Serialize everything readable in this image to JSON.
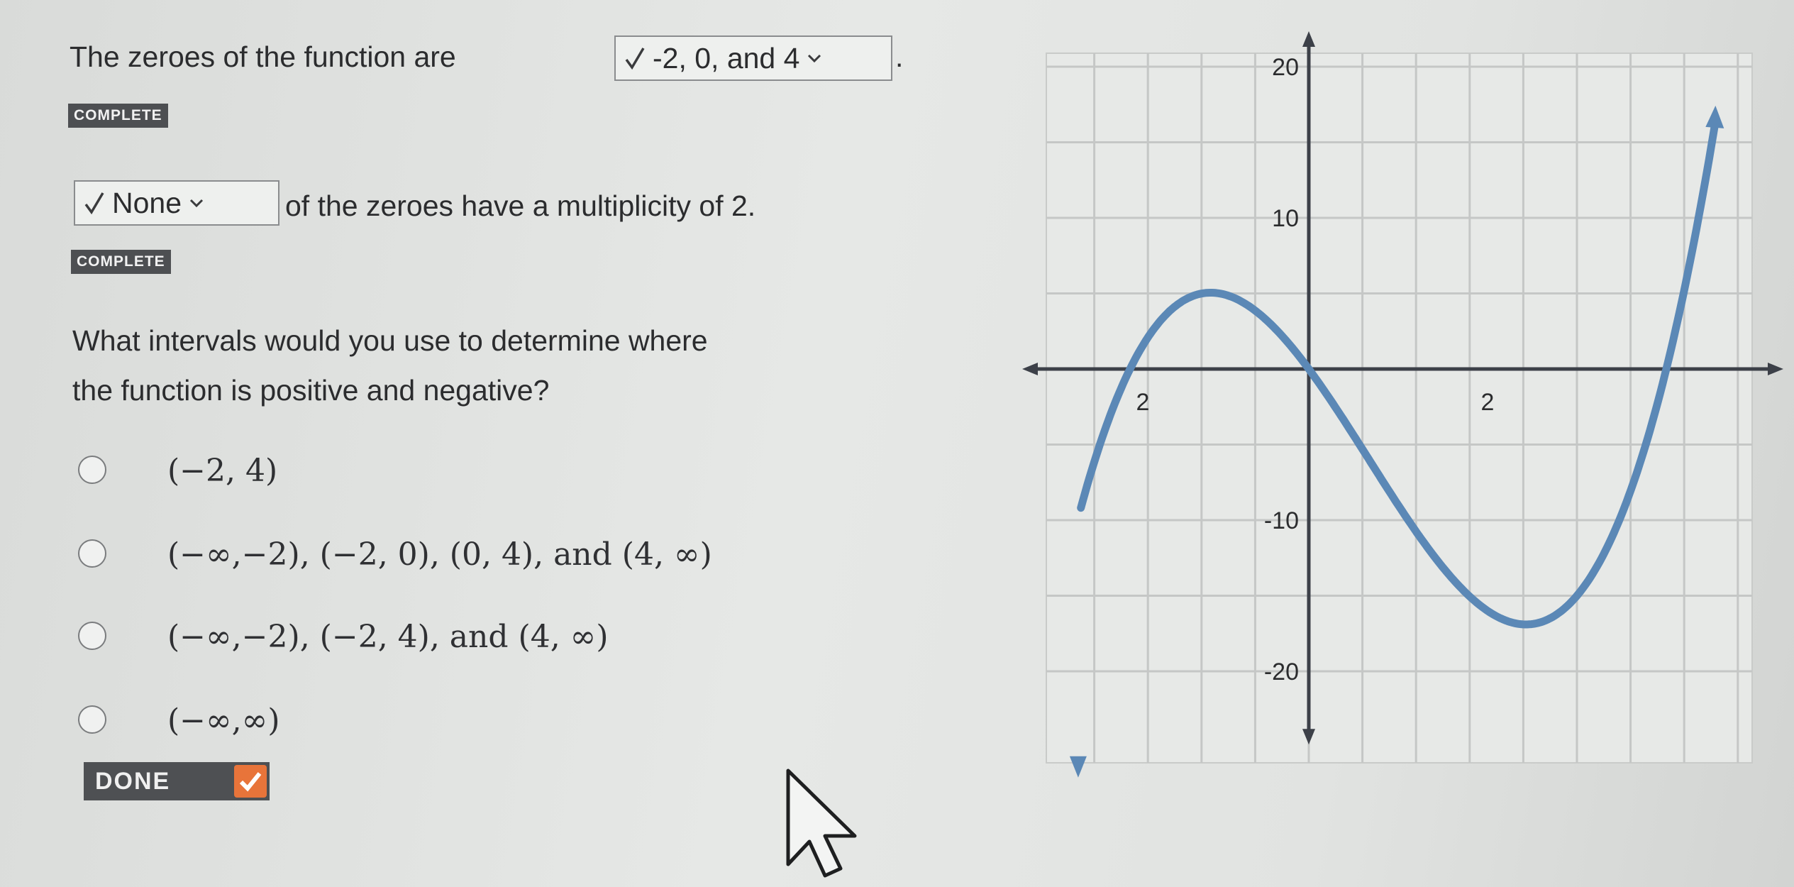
{
  "question1": {
    "prefix": "The zeroes of the function are",
    "dropdown_value": "-2, 0, and 4",
    "suffix": ".",
    "status": "COMPLETE"
  },
  "question2": {
    "dropdown_value": "None",
    "suffix": "of the zeroes have a multiplicity of 2.",
    "status": "COMPLETE"
  },
  "question3": {
    "prompt_line1": "What intervals would you use to determine where",
    "prompt_line2": "the function is positive and negative?",
    "options": [
      {
        "label": "(−2, 4)"
      },
      {
        "label": "(−∞,−2), (−2, 0), (0, 4), and (4, ∞)"
      },
      {
        "label": "(−∞,−2), (−2, 4), and (4, ∞)"
      },
      {
        "label": "(−∞,∞)"
      }
    ]
  },
  "done_button": {
    "label": "DONE"
  },
  "icons": {
    "check": "check-icon",
    "chevron": "chevron-down-icon",
    "cursor": "mouse-pointer-icon"
  },
  "colors": {
    "curve": "#5b88b6",
    "badge": "#4d4f52",
    "done_check": "#e8743a"
  },
  "chart_data": {
    "type": "line",
    "function": "x^3 - 2x^2 - 8x",
    "xlim": [
      -2.5,
      4.6
    ],
    "ylim": [
      -25,
      22
    ],
    "grid": true,
    "x_tick_labels": [
      {
        "value": -2,
        "label": "2"
      },
      {
        "value": 2,
        "label": "2"
      },
      {
        "value": 4,
        "label": ""
      }
    ],
    "y_tick_labels": [
      {
        "value": 20,
        "label": "20"
      },
      {
        "value": 10,
        "label": "10"
      },
      {
        "value": -10,
        "label": "-10"
      },
      {
        "value": -20,
        "label": "-20"
      }
    ],
    "series": [
      {
        "x": [
          -2.45,
          -2.3,
          -2.0,
          -1.7,
          -1.4,
          -1.1,
          -0.87,
          -0.6,
          -0.3,
          0.0,
          0.3,
          0.6,
          0.9,
          1.2,
          1.5,
          1.8,
          2.1,
          2.4,
          2.7,
          3.0,
          3.2,
          3.4,
          3.6,
          3.8,
          4.0,
          4.2,
          4.4,
          4.55
        ],
        "y": [
          -5.2,
          -1.9,
          0.0,
          3.9,
          6.3,
          7.1,
          6.06,
          6.2,
          2.2,
          0.0,
          -2.5,
          -5.3,
          -7.6,
          -9.6,
          -11.1,
          -12.0,
          -12.4,
          -12.0,
          -11.3,
          -9.0,
          -6.8,
          -4.6,
          -2.0,
          1.1,
          0.0,
          3.9,
          7.3,
          9.4
        ]
      }
    ]
  }
}
